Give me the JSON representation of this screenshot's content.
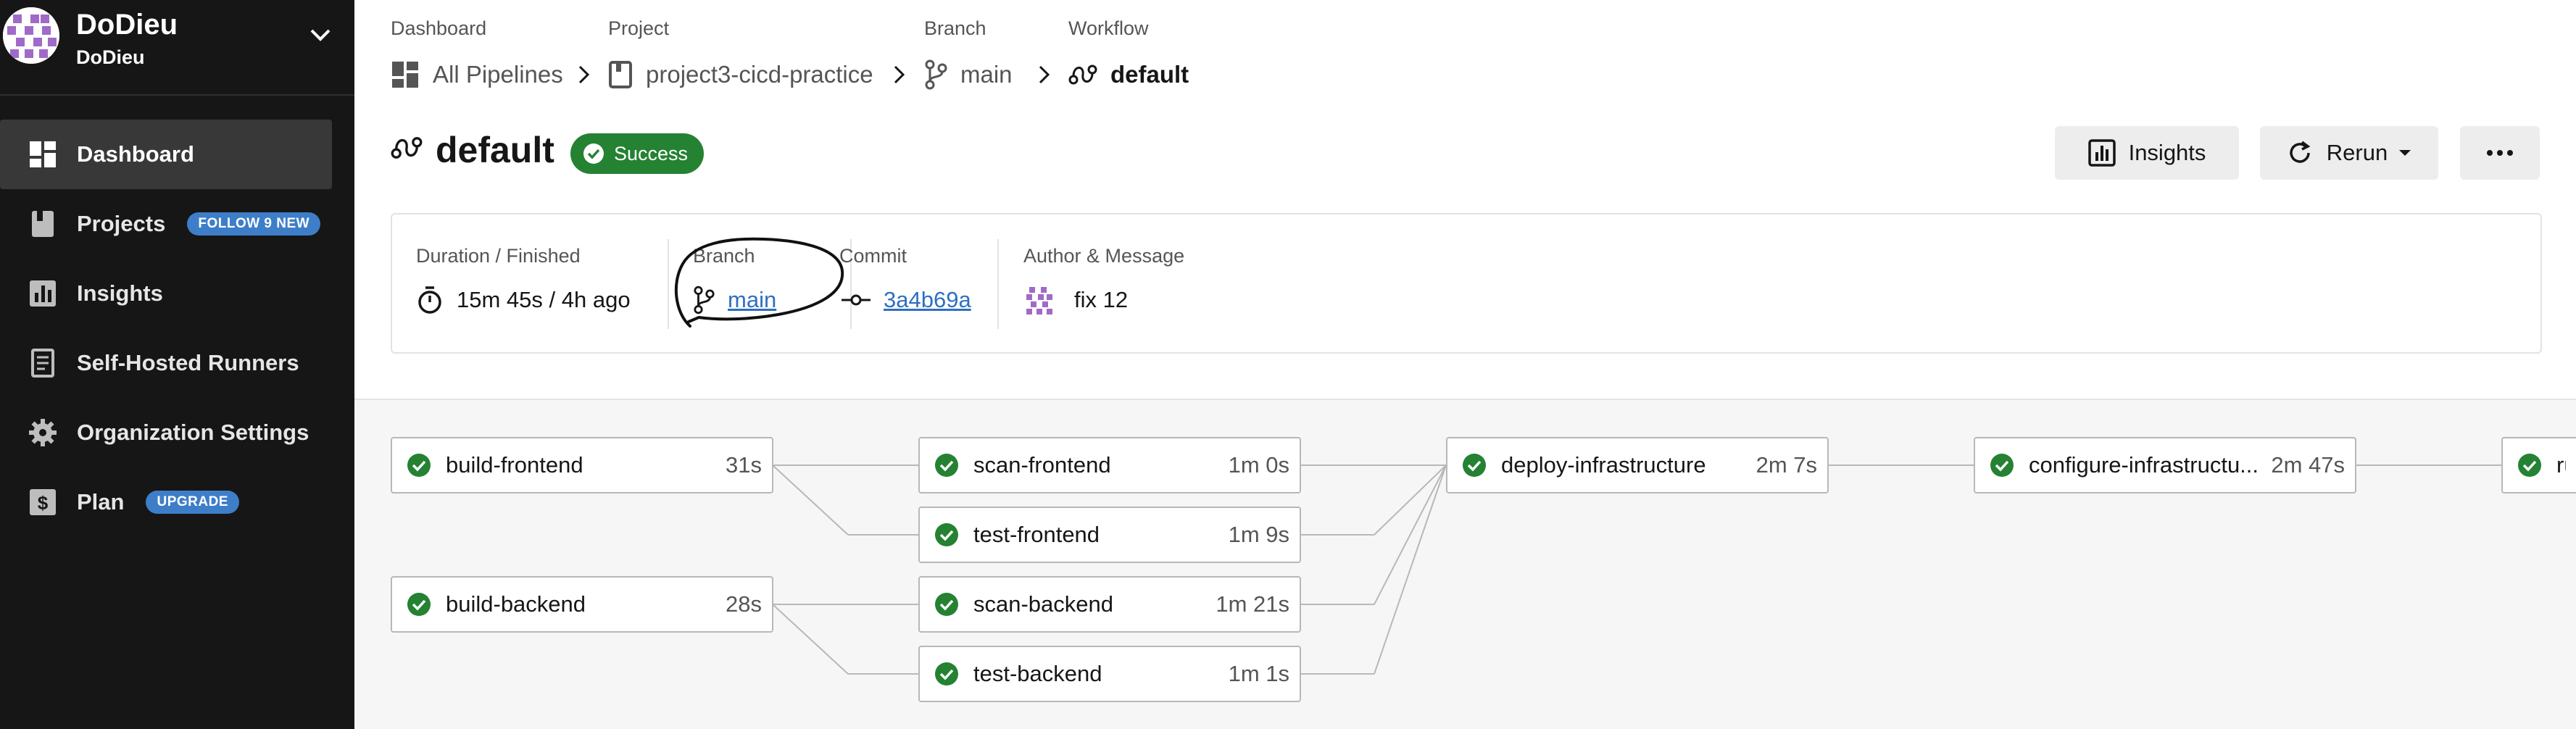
{
  "sidebar": {
    "org_name": "DoDieu",
    "org_sub": "DoDieu",
    "items": [
      {
        "label": "Dashboard",
        "icon": "dashboard-icon",
        "active": true
      },
      {
        "label": "Projects",
        "icon": "book-icon",
        "badge": "FOLLOW 9 NEW"
      },
      {
        "label": "Insights",
        "icon": "bar-chart-icon"
      },
      {
        "label": "Self-Hosted Runners",
        "icon": "runner-icon"
      },
      {
        "label": "Organization Settings",
        "icon": "gear-icon"
      },
      {
        "label": "Plan",
        "icon": "dollar-icon",
        "badge": "UPGRADE"
      }
    ]
  },
  "breadcrumbs": [
    {
      "caption": "Dashboard",
      "label": "All Pipelines",
      "icon": "grid-icon"
    },
    {
      "caption": "Project",
      "label": "project3-cicd-practice",
      "icon": "book-icon"
    },
    {
      "caption": "Branch",
      "label": "main",
      "icon": "branch-icon"
    },
    {
      "caption": "Workflow",
      "label": "default",
      "icon": "workflow-icon"
    }
  ],
  "workflow": {
    "title": "default",
    "status": "Success",
    "status_color": "#248232"
  },
  "actions": {
    "insights": "Insights",
    "rerun": "Rerun",
    "more": "more-icon"
  },
  "details": {
    "duration_caption": "Duration / Finished",
    "duration_value": "15m 45s / 4h ago",
    "branch_caption": "Branch",
    "branch_value": "main",
    "commit_caption": "Commit",
    "commit_value": "3a4b69a",
    "author_caption": "Author & Message",
    "author_message": "fix 12"
  },
  "jobs": [
    {
      "name": "build-frontend",
      "duration": "31s",
      "status": "success"
    },
    {
      "name": "build-backend",
      "duration": "28s",
      "status": "success"
    },
    {
      "name": "scan-frontend",
      "duration": "1m 0s",
      "status": "success"
    },
    {
      "name": "test-frontend",
      "duration": "1m 9s",
      "status": "success"
    },
    {
      "name": "scan-backend",
      "duration": "1m 21s",
      "status": "success"
    },
    {
      "name": "test-backend",
      "duration": "1m 1s",
      "status": "success"
    },
    {
      "name": "deploy-infrastructure",
      "duration": "2m 7s",
      "status": "success"
    },
    {
      "name": "configure-infrastructu...",
      "duration": "2m 47s",
      "status": "success"
    },
    {
      "name": "ru",
      "duration": "",
      "status": "success"
    }
  ],
  "colors": {
    "sidebar_bg": "#161616",
    "success": "#248232",
    "link": "#2f6fc0",
    "badge": "#3e7ec9"
  }
}
